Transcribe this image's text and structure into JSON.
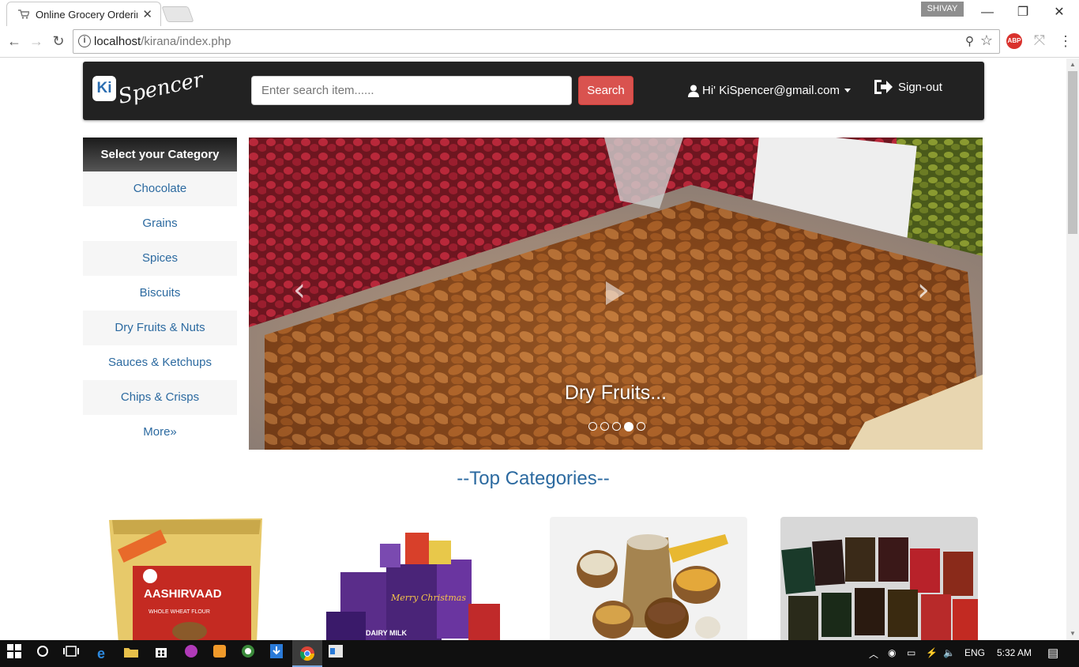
{
  "browser": {
    "tab_title": "Online Grocery Ordering",
    "tab_close": "✕",
    "profile_name": "SHIVAY",
    "url_host": "localhost",
    "url_path": "/kirana/index.php",
    "ext_abp": "ABP",
    "window_controls": {
      "minimize": "—",
      "restore": "❐",
      "close": "✕"
    },
    "nav": {
      "back": "←",
      "forward": "→",
      "reload": "↻"
    }
  },
  "site": {
    "logo_ki": "Ki",
    "logo_text": "Spencer",
    "search_placeholder": "Enter search item......",
    "search_button": "Search",
    "user_greeting": "Hi' KiSpencer@gmail.com",
    "signout": "Sign-out"
  },
  "sidebar": {
    "heading": "Select your Category",
    "items": [
      {
        "label": "Chocolate"
      },
      {
        "label": "Grains"
      },
      {
        "label": "Spices"
      },
      {
        "label": "Biscuits"
      },
      {
        "label": "Dry Fruits & Nuts"
      },
      {
        "label": "Sauces & Ketchups"
      },
      {
        "label": "Chips & Crisps"
      },
      {
        "label": "More»"
      }
    ]
  },
  "carousel": {
    "caption": "Dry Fruits...",
    "prev": "‹",
    "next": "›",
    "slide_count": 5,
    "active_slide": 4
  },
  "top_categories": {
    "title": "--Top Categories--",
    "items": [
      {
        "alt": "Aashirvaad flour",
        "pack_text": "AASHIRVAAD",
        "pack_sub": "WHOLE WHEAT FLOUR"
      },
      {
        "alt": "Chocolates",
        "pack_text": "Merry Christmas",
        "pack_sub": "DAIRY MILK"
      },
      {
        "alt": "Grains"
      },
      {
        "alt": "Spice packets"
      }
    ]
  },
  "taskbar": {
    "lang": "ENG",
    "time": "5:32 AM"
  },
  "colors": {
    "header_bg": "#222222",
    "search_button": "#d9534f",
    "link": "#2c6aa0"
  }
}
